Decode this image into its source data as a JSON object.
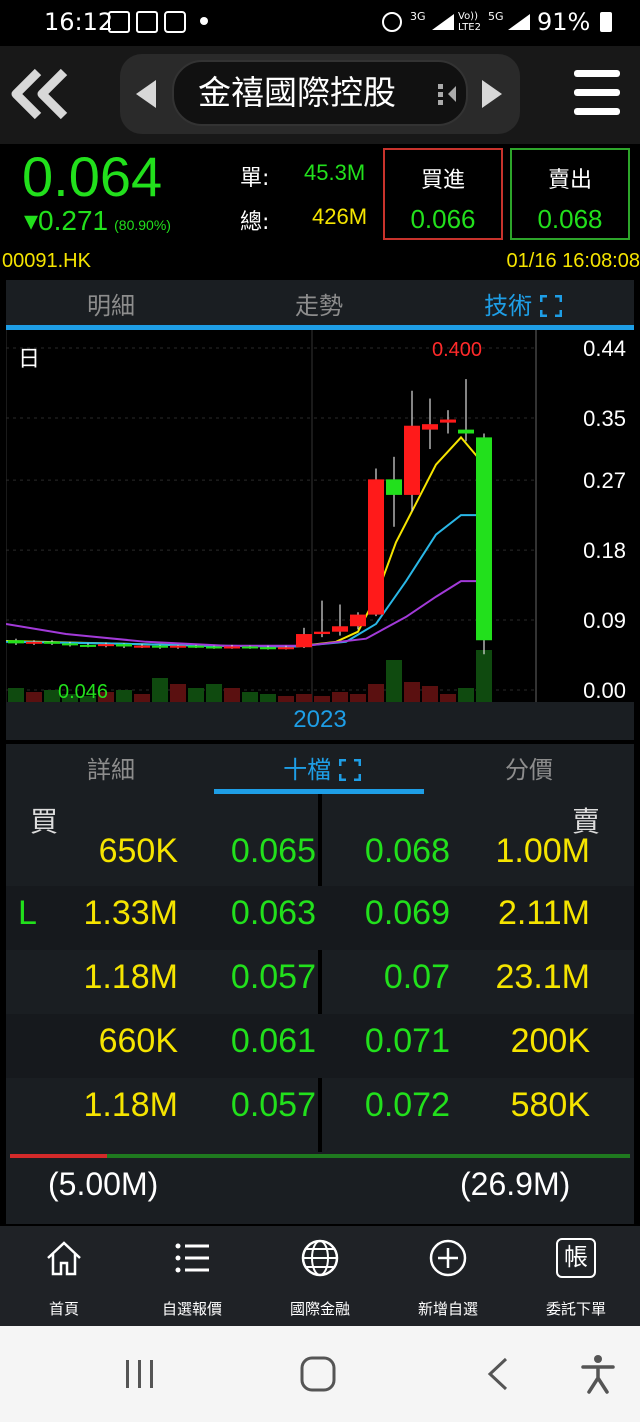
{
  "status_bar": {
    "time": "16:12",
    "network": "3G",
    "volte": "Vo)) LTE2",
    "fiveg": "5G",
    "battery": "91%"
  },
  "header": {
    "title": "金禧國際控股"
  },
  "quote": {
    "last_price": "0.064",
    "change": "▾0.271",
    "change_pct": "(80.90%)",
    "single_label": "單:",
    "single_value": "45.3M",
    "total_label": "總:",
    "total_value": "426M",
    "bid_label": "買進",
    "bid_value": "0.066",
    "ask_label": "賣出",
    "ask_value": "0.068"
  },
  "code_row": {
    "code": "00091.HK",
    "datetime": "01/16 16:08:08"
  },
  "chart_tabs": {
    "tabs": [
      "明細",
      "走勢",
      "技術"
    ],
    "active": 2
  },
  "chart_data": {
    "type": "candlestick",
    "period_label": "日",
    "max_label": "0.400",
    "min_label": "0.046",
    "year_label": "2023",
    "y_ticks": [
      "0.44",
      "0.35",
      "0.27",
      "0.18",
      "0.09",
      "0.00"
    ],
    "ylim": [
      0,
      0.44
    ],
    "colors": {
      "up": "#ff1a1a",
      "down": "#22e01c",
      "ma1": "#f5e400",
      "ma2": "#2ab7e6",
      "ma3": "#a23ad8"
    }
  },
  "book_tabs": {
    "tabs": [
      "詳細",
      "十檔",
      "分價"
    ],
    "active": 1
  },
  "order_book": {
    "buy_label": "買",
    "sell_label": "賣",
    "rows": [
      {
        "flag": "",
        "bid_qty": "650K",
        "bid": "0.065",
        "ask": "0.068",
        "ask_qty": "1.00M"
      },
      {
        "flag": "L",
        "bid_qty": "1.33M",
        "bid": "0.063",
        "ask": "0.069",
        "ask_qty": "2.11M"
      },
      {
        "flag": "",
        "bid_qty": "1.18M",
        "bid": "0.057",
        "ask": "0.07",
        "ask_qty": "23.1M"
      },
      {
        "flag": "",
        "bid_qty": "660K",
        "bid": "0.061",
        "ask": "0.071",
        "ask_qty": "200K"
      },
      {
        "flag": "",
        "bid_qty": "1.18M",
        "bid": "0.057",
        "ask": "0.072",
        "ask_qty": "580K"
      }
    ],
    "buy_total": "(5.00M)",
    "sell_total": "(26.9M)",
    "buy_ratio": 0.157
  },
  "bottom_nav": {
    "items": [
      {
        "label": "首頁",
        "icon": "home-icon"
      },
      {
        "label": "自選報價",
        "icon": "watchlist-icon"
      },
      {
        "label": "國際金融",
        "icon": "globe-icon"
      },
      {
        "label": "新增自選",
        "icon": "add-circle-icon"
      },
      {
        "label": "委託下單",
        "icon": "order-icon"
      }
    ],
    "order_glyph": "帳"
  }
}
